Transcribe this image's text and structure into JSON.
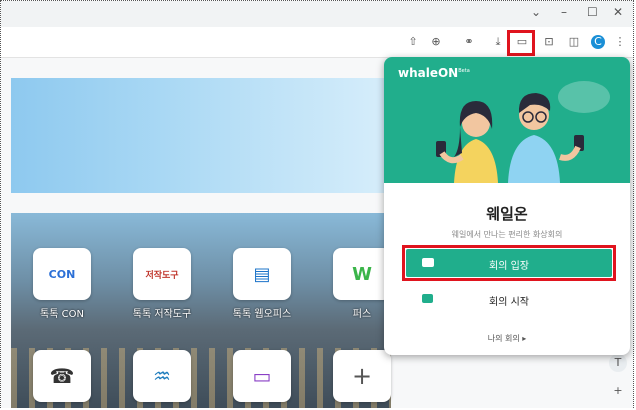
{
  "window_controls": {
    "menu": "⌄",
    "minimize": "–",
    "maximize": "☐",
    "close": "✕"
  },
  "toolbar": {
    "icons": [
      "share-icon",
      "zoom-icon",
      "translate-icon",
      "download-icon",
      "whaleon-icon",
      "screenshot-icon",
      "sidebar-icon",
      "profile-icon",
      "more-icon"
    ],
    "profile_initial": "C"
  },
  "apps": [
    {
      "label": "톡톡 CON",
      "tile": "CON",
      "color": "#2b6fd6"
    },
    {
      "label": "톡톡 저작도구",
      "tile": "저작도구",
      "color": "#c0362c"
    },
    {
      "label": "톡톡 웹오피스",
      "tile": "▤",
      "color": "#1d74c9"
    },
    {
      "label": "퍼스",
      "tile": "W",
      "color": "#3bb54a"
    },
    {
      "label": "",
      "tile": "☎",
      "color": "#333333"
    },
    {
      "label": "",
      "tile": "♒",
      "color": "#1f7dbd"
    },
    {
      "label": "",
      "tile": "▭",
      "color": "#8a3fc6"
    },
    {
      "label": "",
      "tile": "+",
      "color": "#555555"
    }
  ],
  "popup": {
    "brand": "whaleON",
    "brand_mark": "Beta",
    "title": "웨일온",
    "subtitle": "웨일에서 만나는 편리한 화상회의",
    "join_label": "회의 입장",
    "start_label": "회의 시작",
    "more_label": "나의 회의 ▸"
  },
  "accent": "#20ae8c",
  "highlight_color": "#e0141e"
}
